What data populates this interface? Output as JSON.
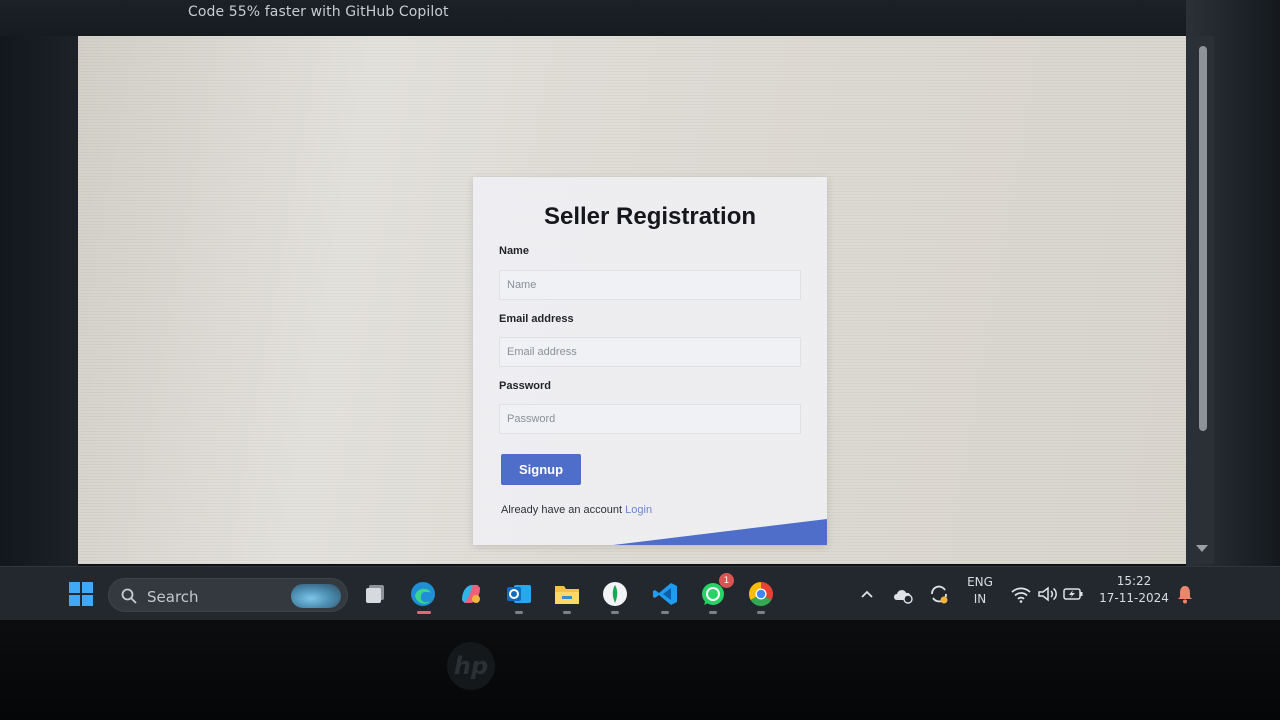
{
  "banner": {
    "text": "Code 55% faster with GitHub Copilot"
  },
  "form": {
    "title": "Seller Registration",
    "name_label": "Name",
    "name_placeholder": "Name",
    "email_label": "Email address",
    "email_placeholder": "Email address",
    "password_label": "Password",
    "password_placeholder": "Password",
    "signup_label": "Signup",
    "login_prompt": "Already have an account",
    "login_link": "Login"
  },
  "taskbar": {
    "search_label": "Search",
    "apps": [
      {
        "name": "windows-start-icon",
        "active": false
      },
      {
        "name": "task-view-icon",
        "active": false
      },
      {
        "name": "edge-icon",
        "active": true
      },
      {
        "name": "copilot-icon",
        "active": false
      },
      {
        "name": "outlook-icon",
        "active": false
      },
      {
        "name": "file-explorer-icon",
        "active": false
      },
      {
        "name": "mongodb-compass-icon",
        "active": false
      },
      {
        "name": "vscode-icon",
        "active": false
      },
      {
        "name": "whatsapp-icon",
        "active": false,
        "badge": "1"
      },
      {
        "name": "chrome-icon",
        "active": false
      }
    ],
    "tray": {
      "lang_line1": "ENG",
      "lang_line2": "IN",
      "time": "15:22",
      "date": "17-11-2024"
    }
  },
  "colors": {
    "accent": "#4e6ec9",
    "link": "#6b87cf",
    "taskbar": "#23282e",
    "page_bg": "#dedbd4"
  }
}
